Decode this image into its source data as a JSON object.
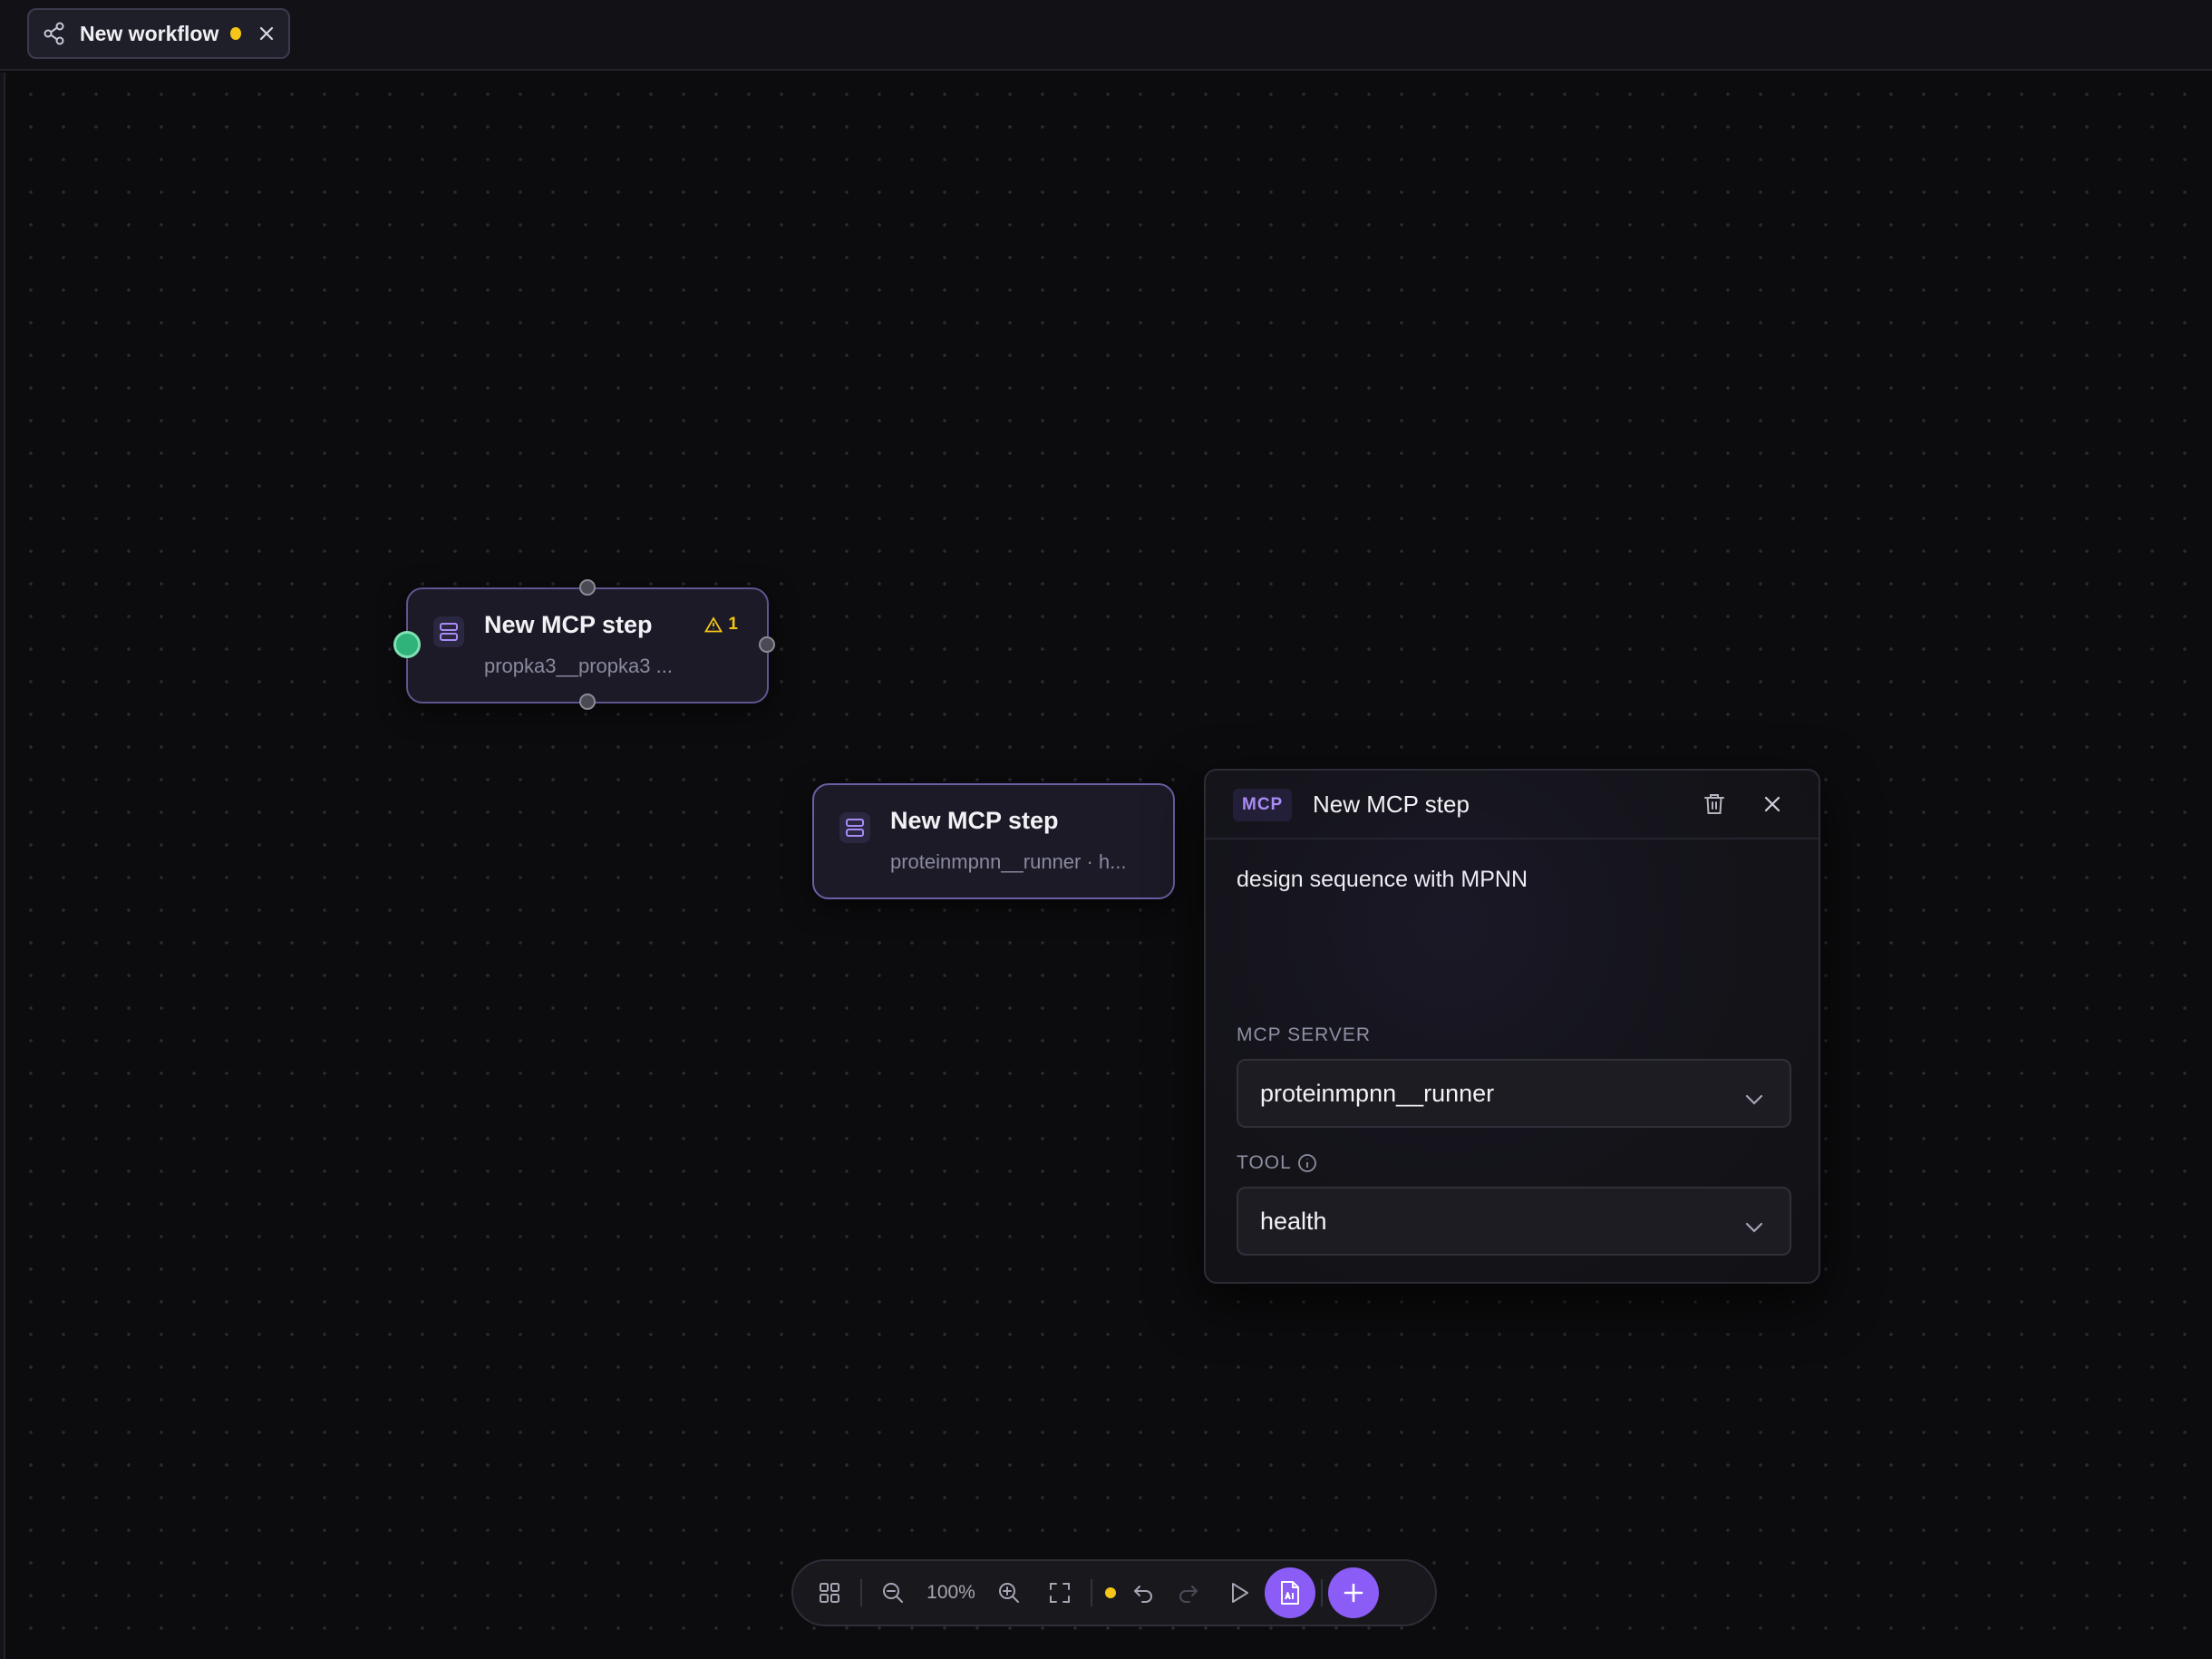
{
  "tab": {
    "label": "New workflow"
  },
  "nodes": [
    {
      "title": "New MCP step",
      "subtitle": "propka3__propka3 ...",
      "warning_count": "1"
    },
    {
      "title": "New MCP step",
      "subtitle": "proteinmpnn__runner · h..."
    }
  ],
  "panel": {
    "badge": "MCP",
    "title": "New MCP step",
    "description": "design sequence with MPNN",
    "server_label": "MCP SERVER",
    "server_value": "proteinmpnn__runner",
    "tool_label": "TOOL",
    "tool_value": "health"
  },
  "toolbar": {
    "zoom": "100%"
  },
  "colors": {
    "accent": "#8b5cf6",
    "warning": "#f5c518",
    "connected": "#2fb37a"
  }
}
